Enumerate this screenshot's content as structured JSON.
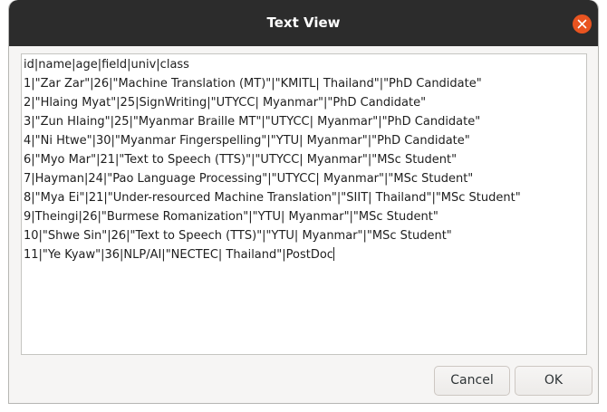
{
  "window": {
    "title": "Text View"
  },
  "text_view": {
    "lines": [
      "id|name|age|field|univ|class",
      "1|\"Zar Zar\"|26|\"Machine Translation (MT)\"|\"KMITL| Thailand\"|\"PhD Candidate\"",
      "2|\"Hlaing Myat\"|25|SignWriting|\"UTYCC| Myanmar\"|\"PhD Candidate\"",
      "3|\"Zun Hlaing\"|25|\"Myanmar Braille MT\"|\"UTYCC| Myanmar\"|\"PhD Candidate\"",
      "4|\"Ni Htwe\"|30|\"Myanmar Fingerspelling\"|\"YTU| Myanmar\"|\"PhD Candidate\"",
      "6|\"Myo Mar\"|21|\"Text to Speech (TTS)\"|\"UTYCC| Myanmar\"|\"MSc Student\"",
      "7|Hayman|24|\"Pao Language Processing\"|\"UTYCC| Myanmar\"|\"MSc Student\"",
      "8|\"Mya Ei\"|21|\"Under-resourced Machine Translation\"|\"SIIT| Thailand\"|\"MSc Student\"",
      "9|Theingi|26|\"Burmese Romanization\"|\"YTU| Myanmar\"|\"MSc Student\"",
      "10|\"Shwe Sin\"|26|\"Text to Speech (TTS)\"|\"YTU| Myanmar\"|\"MSc Student\"",
      "11|\"Ye Kyaw\"|36|NLP/AI|\"NECTEC| Thailand\"|PostDoc"
    ]
  },
  "buttons": {
    "cancel": "Cancel",
    "ok": "OK"
  },
  "colors": {
    "titlebar": "#2c2c2c",
    "close_button": "#e95420",
    "dialog_background": "#f6f5f4"
  },
  "icons": {
    "close": "close-icon"
  }
}
